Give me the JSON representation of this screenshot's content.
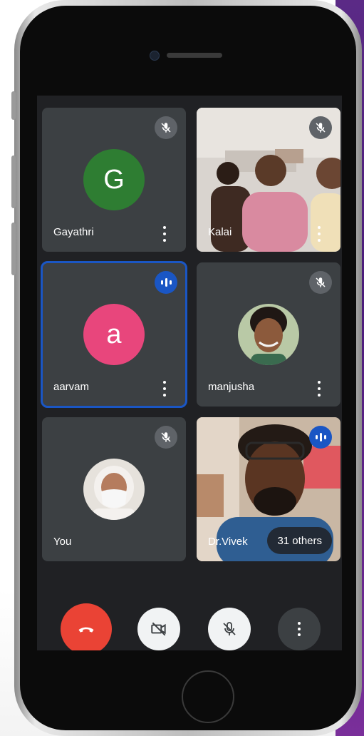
{
  "participants": [
    {
      "name": "Gayathri",
      "initial": "G",
      "avatar_color": "#2e7d32",
      "mic": "muted"
    },
    {
      "name": "Kalai",
      "mic": "muted",
      "video": "on"
    },
    {
      "name": "aarvam",
      "initial": "a",
      "avatar_color": "#e8467c",
      "mic": "speaking",
      "active": true
    },
    {
      "name": "manjusha",
      "mic": "muted",
      "avatar": "photo"
    },
    {
      "name": "You",
      "mic": "muted",
      "avatar": "photo"
    },
    {
      "name": "Dr.Vivek",
      "mic": "speaking",
      "video": "on"
    }
  ],
  "overflow": {
    "label": "31 others"
  },
  "controls": [
    {
      "name": "end-call",
      "icon": "phone-hangup-icon",
      "color": "#ea4335"
    },
    {
      "name": "camera-toggle",
      "icon": "video-off-icon",
      "state": "off"
    },
    {
      "name": "mic-toggle",
      "icon": "mic-off-icon",
      "state": "off"
    },
    {
      "name": "more-options",
      "icon": "more-vertical-icon"
    }
  ],
  "colors": {
    "background": "#202124",
    "tile": "#3c4043",
    "accent": "#1a56c4",
    "end_call": "#ea4335"
  }
}
